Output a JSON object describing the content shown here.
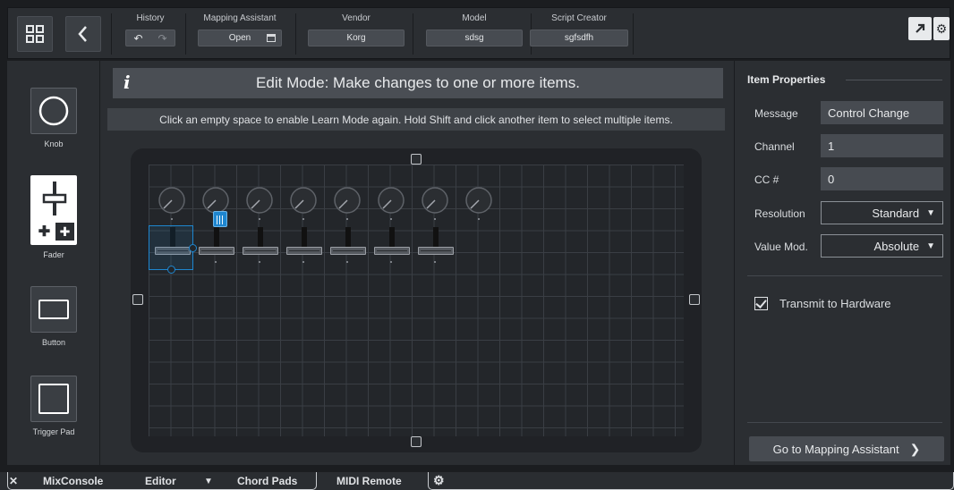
{
  "toolbar": {
    "history": {
      "label": "History",
      "undo_icon": "undo-icon",
      "redo_icon": "redo-icon"
    },
    "mapping_assistant": {
      "label": "Mapping Assistant",
      "value": "Open",
      "icon": "window-icon"
    },
    "vendor": {
      "label": "Vendor",
      "value": "Korg"
    },
    "model": {
      "label": "Model",
      "value": "sdsg"
    },
    "script_creator": {
      "label": "Script Creator",
      "value": "sgfsdfh"
    }
  },
  "palette": {
    "items": [
      {
        "label": "Knob",
        "icon": "knob-icon"
      },
      {
        "label": "Fader",
        "icon": "fader-icon"
      },
      {
        "label": "Button",
        "icon": "button-icon"
      },
      {
        "label": "Trigger Pad",
        "icon": "trigger-pad-icon"
      }
    ]
  },
  "editor": {
    "banner_icon": "i",
    "banner_text": "Edit Mode: Make changes to one or more items.",
    "hint": "Click an empty space to enable Learn Mode again. Hold Shift and click another item to select multiple items."
  },
  "properties": {
    "title": "Item Properties",
    "message_label": "Message",
    "message_value": "Control Change",
    "channel_label": "Channel",
    "channel_value": "1",
    "cc_label": "CC #",
    "cc_value": "0",
    "resolution_label": "Resolution",
    "resolution_value": "Standard",
    "value_mod_label": "Value Mod.",
    "value_mod_value": "Absolute",
    "transmit_label": "Transmit to Hardware",
    "transmit_checked": true,
    "go_button": "Go to Mapping Assistant"
  },
  "bottom_tabs": {
    "close": "✕",
    "mixconsole": "MixConsole",
    "editor": "Editor",
    "chord_pads": "Chord Pads",
    "midi_remote": "MIDI Remote"
  },
  "colors": {
    "accent": "#1e86cf",
    "panel": "#2b2e32",
    "background": "#1b1d20"
  }
}
